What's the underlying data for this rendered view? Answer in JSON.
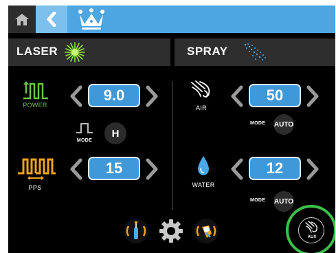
{
  "nav": {
    "home_icon": "home-icon",
    "back_icon": "chevron-left-icon",
    "brand_icon": "crown-icon",
    "bar_color": "#4da5e2",
    "back_color": "#7cc0ee"
  },
  "laser": {
    "title": "LASER",
    "icon": "laser-starburst-icon",
    "power": {
      "label": "POWER",
      "value": "9.0"
    },
    "mode": {
      "label": "MODE",
      "value": "H"
    },
    "pps": {
      "label": "PPS",
      "value": "15"
    }
  },
  "spray": {
    "title": "SPRAY",
    "icon": "spray-dots-icon",
    "air": {
      "label": "AIR",
      "value": "50",
      "mode_label": "MODE",
      "mode_value": "AUTO"
    },
    "water": {
      "label": "WATER",
      "value": "12",
      "mode_label": "MODE",
      "mode_value": "AUTO"
    }
  },
  "bottom": {
    "tools": [
      "fiber-tip-icon",
      "settings-gear-icon",
      "handpiece-icon"
    ],
    "aux_label": "AUX",
    "aux_ring_color": "#3cc04a"
  },
  "colors": {
    "value_box": "#3f98d8",
    "power_green": "#6dc24a",
    "pps_orange": "#f0a31e",
    "water_blue": "#4aa8e8"
  }
}
